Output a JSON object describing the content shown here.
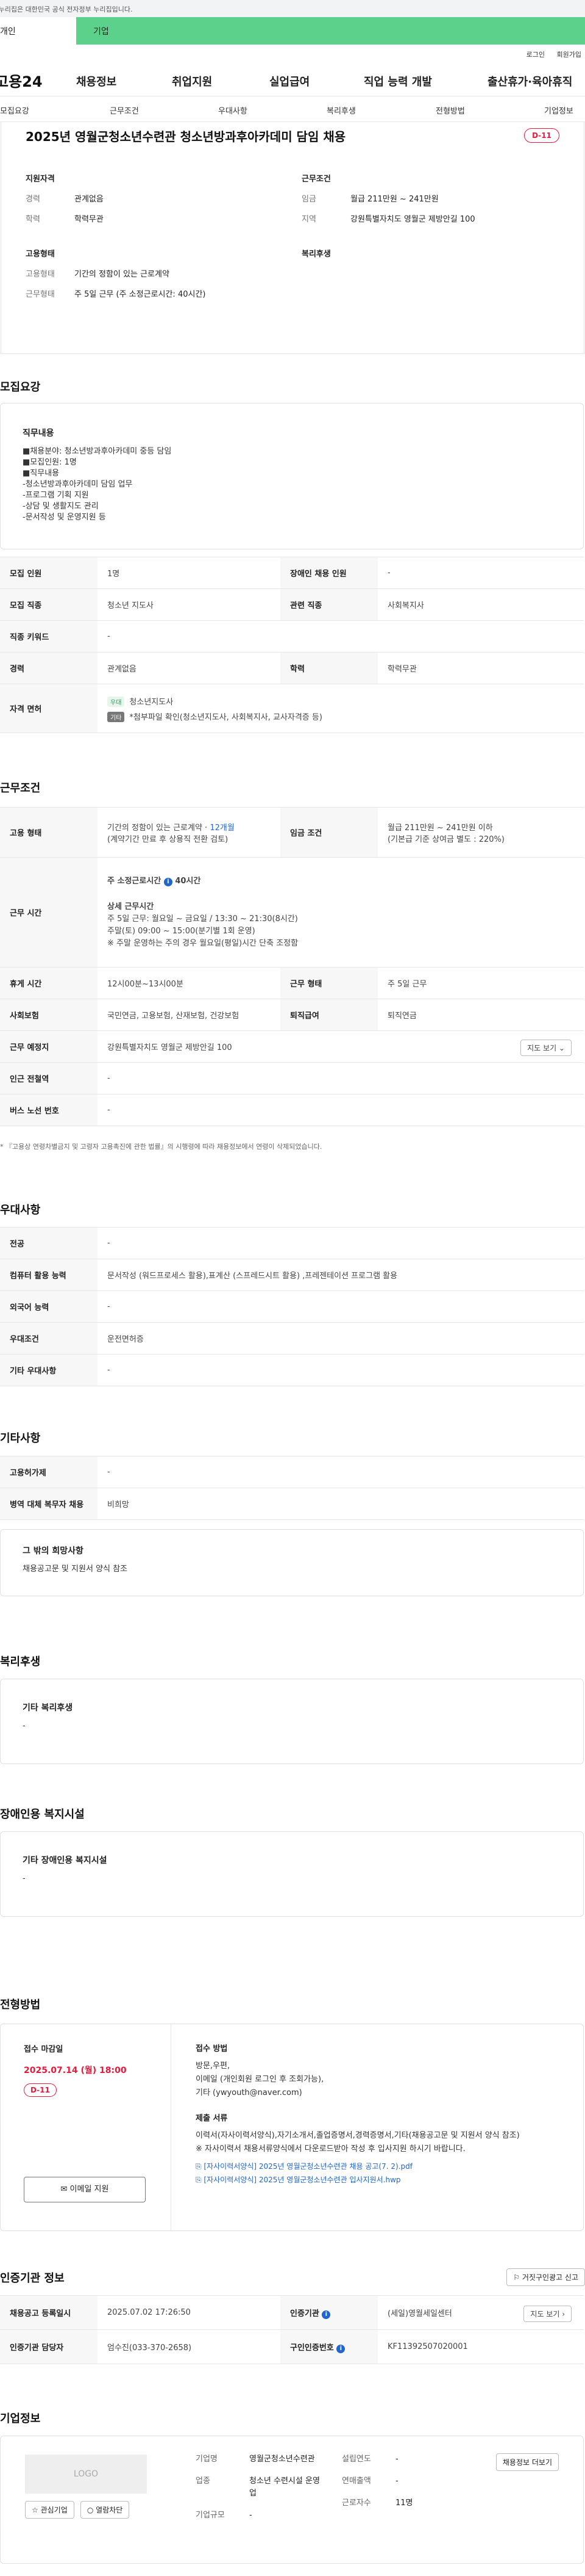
{
  "gov_banner": "이 누리집은 대한민국 공식 전자정부 누리집입니다.",
  "top_tabs": [
    "개인",
    "기업"
  ],
  "util_links": [
    "로그인",
    "회원가입"
  ],
  "logo": "고용24",
  "gnb": [
    "채용정보",
    "취업지원",
    "실업급여",
    "직업 능력 개발",
    "출산휴가·육아휴직"
  ],
  "lnb": [
    "모집요강",
    "근무조건",
    "우대사항",
    "복리후생",
    "전형방법",
    "기업정보"
  ],
  "job_title": "2025년 영월군청소년수련관 청소년방과후아카데미 담임 채용",
  "dday": "D-11",
  "summary": {
    "qual_title": "지원자격",
    "career_label": "경력",
    "career": "관계없음",
    "edu_label": "학력",
    "edu": "학력무관",
    "cond_title": "근무조건",
    "wage_label": "임금",
    "wage": "월급 211만원 ~ 241만원",
    "loc_label": "지역",
    "loc": "강원특별자치도 영월군 제방안길 100",
    "emp_title": "고용형태",
    "emptype_label": "고용형태",
    "emptype": "기간의 정함이 있는 근로계약",
    "worktype_label": "근무형태",
    "worktype": "주 5일 근무 (주 소정근로시간: 40시간)",
    "welfare_title": "복리후생"
  },
  "recruit": {
    "section_title": "모집요강",
    "desc_title": "직무내용",
    "desc": "■채용분야: 청소년방과후아카데미 중등 담임\n■모집인원: 1명\n■직무내용\n-청소년방과후아카데미 담임 업무\n-프로그램 기획 지원\n-상담 및 생활지도 관리\n-문서작성 및 운영지원 등",
    "rows": {
      "headcount_h": "모집 인원",
      "headcount": "1명",
      "disabled_h": "장애인 채용 인원",
      "disabled": "-",
      "job_h": "모집 직종",
      "job": "청소년 지도사",
      "related_h": "관련 직종",
      "related": "사회복지사",
      "kw_h": "직종 키워드",
      "kw": "-",
      "career_h": "경력",
      "career": "관계없음",
      "edu_h": "학력",
      "edu": "학력무관",
      "cert_h": "자격 면허",
      "cert_tag1": "우대",
      "cert1": "청소년지도사",
      "cert_tag2": "기타",
      "cert2": "*첨부파일 확인(청소년지도사, 사회복지사, 교사자격증 등)"
    }
  },
  "conditions": {
    "section_title": "근무조건",
    "emp_h": "고용 형태",
    "emp1": "기간의 정함이 있는 근로계약 · ",
    "emp_months": "12개월",
    "emp2": "(계약기간 만료 후 상용직 전환 검토)",
    "wage_h": "임금 조건",
    "wage1": "월급 211만원 ~ 241만원 이하",
    "wage2": "(기본급 기준 상여금 별도 : 220%)",
    "time_h": "근무 시간",
    "weekly": "주 소정근로시간 ",
    "weekly_badge": "i",
    "weekly_hours": "40시간",
    "detail_title": "상세 근무시간",
    "detail1": "주 5일 근무: 월요일 ~ 금요일 / 13:30 ~ 21:30(8시간)",
    "detail2": "주말(토) 09:00 ~ 15:00(분기별 1회 운영)",
    "detail3": "※ 주말 운영하는 주의 경우 월요일(평일)시간 단축 조정함",
    "rest_h": "휴게 시간",
    "rest": "12시00분~13시00분",
    "shift_h": "근무 형태",
    "shift": "주 5일 근무",
    "ins_h": "사회보험",
    "ins": "국민연금, 고용보험, 산재보험, 건강보험",
    "retire_h": "퇴직급여",
    "retire": "퇴직연금",
    "place_h": "근무 예정지",
    "place": "강원특별자치도 영월군 제방안길 100",
    "map_btn": "지도 보기 ⌄",
    "subway_h": "인근 전철역",
    "subway": "-",
    "bus_h": "버스 노선 번호",
    "bus": "-",
    "note": "* 『고용상 연령차별금지 및 고령자 고용촉진에 관한 법률』의 시행령에 따라 채용정보에서 연령이 삭제되었습니다."
  },
  "preferences": {
    "section_title": "우대사항",
    "major_h": "전공",
    "major": "-",
    "pc_h": "컴퓨터 활용 능력",
    "pc": "문서작성 (워드프로세스 활용),표계산 (스프레드시트 활용) ,프레젠테이션 프로그램 활용",
    "lang_h": "외국어 능력",
    "lang": "-",
    "pref_h": "우대조건",
    "pref": "운전면허증",
    "etc_h": "기타 우대사항",
    "etc": "-"
  },
  "others": {
    "section_title": "기타사항",
    "disab_h": "고용허가제",
    "disab": "-",
    "military_h": "병역 대체 복무자 채용",
    "military": "비희망",
    "extra_title": "그 밖의 희망사항",
    "extra": "채용공고문 및 지원서 양식 참조"
  },
  "welfare": {
    "section_title": "복리후생",
    "box_title": "기타 복리후생",
    "box_val": "-"
  },
  "disability_fac": {
    "section_title": "장애인용 복지시설",
    "box_title": "기타 장애인용 복지시설",
    "box_val": "-"
  },
  "apply": {
    "section_title": "전형방법",
    "deadline_title": "접수 마감일",
    "deadline": "2025.07.14 (월) 18:00",
    "dday": "D-11",
    "email_btn": "이메일 지원",
    "method_title": "접수 방법",
    "method": "방문,우편,\n이메일 (개인회원 로그인 후 조회가능),\n기타 (ywyouth@naver.com)",
    "docs_title": "제출 서류",
    "docs": "이력서(자사이력서양식),자기소개서,졸업증명서,경력증명서,기타(채용공고문 및 지원서 양식 참조)\n※ 자사이력서 채용서류양식에서 다운로드받아 작성 후 입사지원 하시기 바랍니다.",
    "file1": "[자사이력서양식] 2025년 영월군청소년수련관 채용 공고(7. 2).pdf",
    "file2": "[자사이력서양식] 2025년 영월군청소년수련관 입사지원서.hwp"
  },
  "cert": {
    "section_title": "인증기관 정보",
    "report_btn": "거짓구인광고 신고",
    "reg_h": "채용공고 등록일시",
    "reg": "2025.07.02 17:26:50",
    "agency_h": "인증기관",
    "agency": "(세일)영월세일센터",
    "map_btn": "지도 보기 ›",
    "manager_h": "인증기관 담당자",
    "manager": "엄수진(033-370-2658)",
    "num_h": "구인인증번호",
    "num": "KF11392507020001"
  },
  "company": {
    "section_title": "기업정보",
    "logo_text": "LOGO",
    "fav_btn": "☆ 관심기업",
    "view_btn": "○ 열람차단",
    "name_h": "기업명",
    "name": "영월군청소년수련관",
    "industry_h": "업종",
    "industry": "청소년 수련시설 운영업",
    "scale_h": "기업규모",
    "scale": "-",
    "founded_h": "설립연도",
    "founded": "-",
    "revenue_h": "연매출액",
    "revenue": "-",
    "workers_h": "근로자수",
    "workers": "11명",
    "info_btn": "채용정보 더보기"
  },
  "colors": {
    "accent_green": "#5cd18b",
    "dday_red": "#e21c3c",
    "link_blue": "#2266cc"
  }
}
